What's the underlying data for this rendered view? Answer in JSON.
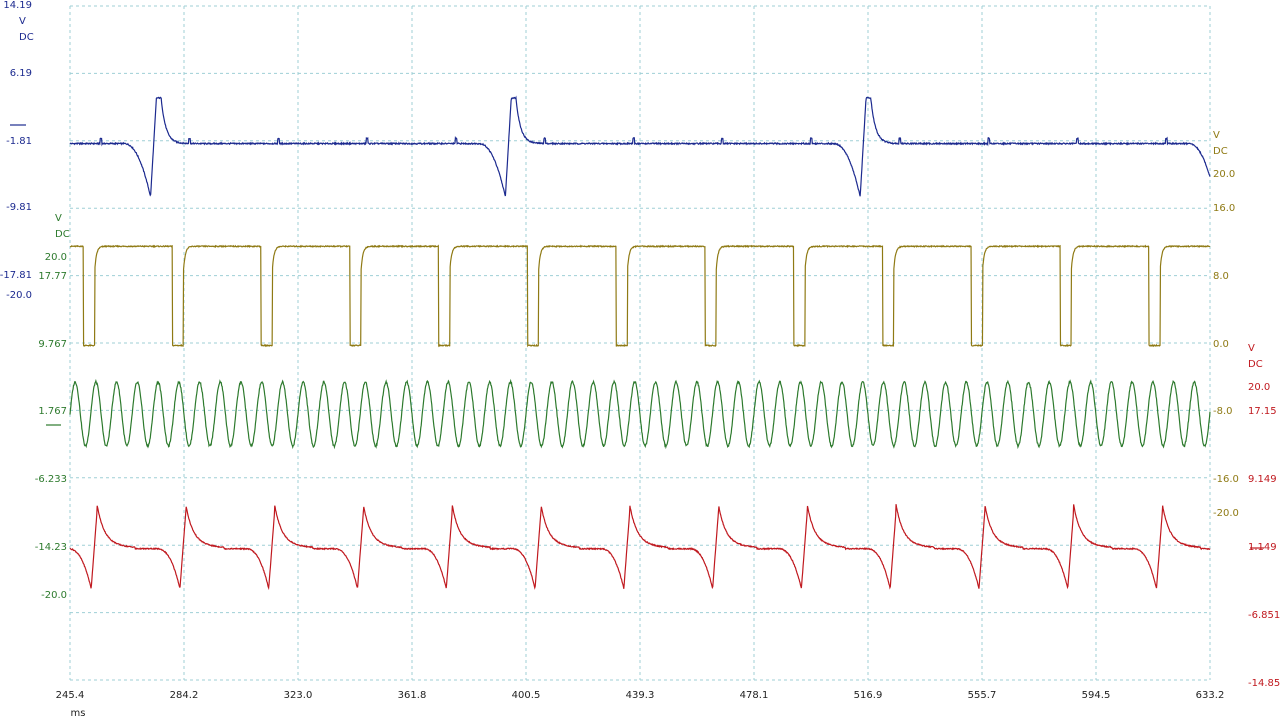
{
  "chart_data": {
    "type": "line",
    "x_axis": {
      "unit": "ms",
      "range": [
        245.4,
        633.2
      ],
      "ticks": [
        "245.4",
        "284.2",
        "323.0",
        "361.8",
        "400.5",
        "439.3",
        "478.1",
        "516.9",
        "555.7",
        "594.5",
        "633.2"
      ]
    },
    "grid": true,
    "channels": [
      {
        "key": "blue",
        "color": "#1c2a8f",
        "side": "left",
        "unit_labels": [
          "V",
          "DC"
        ],
        "ticks": [
          "14.19",
          "6.19",
          "-1.81",
          "-9.81",
          "-17.81",
          "-20.0"
        ],
        "range": [
          -20.0,
          14.19
        ],
        "baseline": -1.81,
        "period_ms": 120.7,
        "first_spike_ms": 275.8,
        "spike_high": 3.5,
        "spike_low": -8.0
      },
      {
        "key": "olive",
        "color": "#8f7a14",
        "side": "right",
        "unit_labels": [
          "V",
          "DC"
        ],
        "ticks": [
          "20.0",
          "16.0",
          "8.0",
          "0.0",
          "-8.0",
          "-16.0",
          "-20.0"
        ],
        "range": [
          -20.0,
          20.0
        ],
        "high": 11.5,
        "low": 0.0,
        "period_ms": 30.2,
        "first_fall_ms": 250.0,
        "low_duration_ms": 3.8
      },
      {
        "key": "green",
        "color": "#2d7a2d",
        "side": "left",
        "unit_labels": [
          "V",
          "DC"
        ],
        "ticks": [
          "20.0",
          "17.77",
          "9.767",
          "1.767",
          "-6.233",
          "-14.23",
          "-20.0"
        ],
        "range": [
          -20.0,
          20.0
        ],
        "center": 1.5,
        "amplitude": 3.7,
        "period_ms": 7.05
      },
      {
        "key": "red",
        "color": "#c0191f",
        "side": "right",
        "unit_labels": [
          "V",
          "DC"
        ],
        "ticks": [
          "20.0",
          "17.15",
          "9.149",
          "1.149",
          "-6.851",
          "-14.85"
        ],
        "range": [
          -14.85,
          20.0
        ],
        "baseline": 1.149,
        "period_ms": 30.2,
        "first_spike_ms": 254.6,
        "spike_high": 5.5,
        "spike_low": -3.5
      }
    ]
  }
}
